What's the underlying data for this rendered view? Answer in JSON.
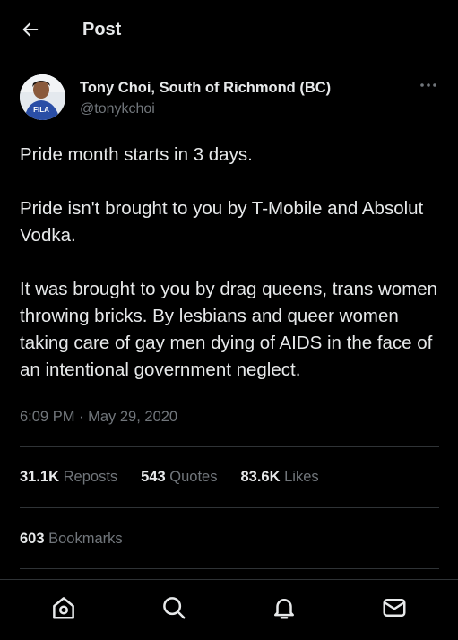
{
  "header": {
    "title": "Post"
  },
  "author": {
    "name": "Tony Choi, South of Richmond (BC)",
    "handle": "@tonykchoi",
    "shirt_text": "FILA"
  },
  "tweet": {
    "paragraphs": [
      "Pride month starts in 3 days.",
      "Pride isn't brought to you by T-Mobile and Absolut Vodka.",
      "It was brought to you by drag queens, trans women throwing bricks. By lesbians and queer women taking care of gay men dying of AIDS in the face of an intentional government neglect."
    ]
  },
  "meta": {
    "timestamp": "6:09 PM · May 29, 2020"
  },
  "stats": {
    "reposts": {
      "count": "31.1K",
      "label": "Reposts"
    },
    "quotes": {
      "count": "543",
      "label": "Quotes"
    },
    "likes": {
      "count": "83.6K",
      "label": "Likes"
    },
    "bookmarks": {
      "count": "603",
      "label": "Bookmarks"
    }
  },
  "tabbar": {
    "items": [
      {
        "name": "home",
        "icon": "home-icon"
      },
      {
        "name": "search",
        "icon": "search-icon"
      },
      {
        "name": "notifications",
        "icon": "bell-icon"
      },
      {
        "name": "messages",
        "icon": "mail-icon"
      }
    ]
  },
  "colors": {
    "background": "#000000",
    "text": "#e7e9ea",
    "secondary": "#71767b",
    "divider": "#2f3336"
  }
}
